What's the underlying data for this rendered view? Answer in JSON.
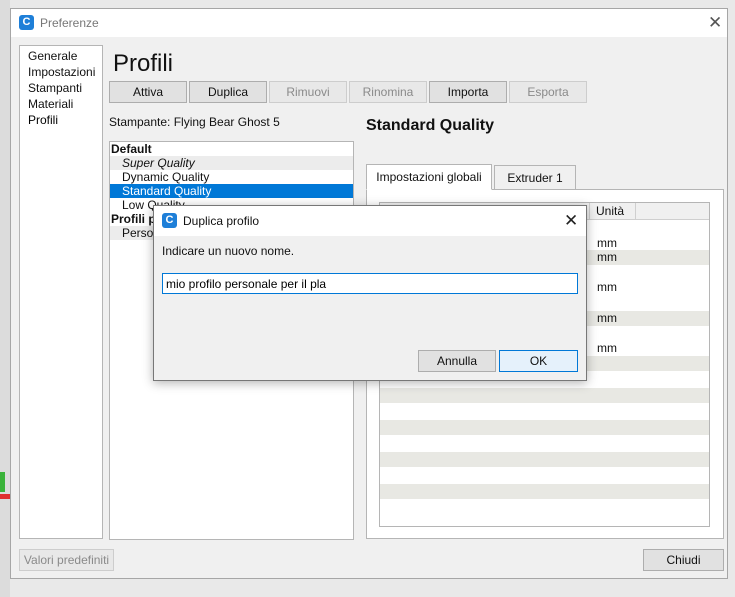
{
  "window": {
    "title": "Preferenze",
    "close_glyph": "✕",
    "logo_glyph": "C"
  },
  "sidebar": {
    "items": [
      {
        "label": "Generale"
      },
      {
        "label": "Impostazioni"
      },
      {
        "label": "Stampanti"
      },
      {
        "label": "Materiali"
      },
      {
        "label": "Profili"
      }
    ],
    "selected": "Profili"
  },
  "page": {
    "title": "Profili"
  },
  "toolbar": {
    "activate": "Attiva",
    "duplicate": "Duplica",
    "remove": "Rimuovi",
    "rename": "Rinomina",
    "import": "Importa",
    "export": "Esporta"
  },
  "printer_label": "Stampante: Flying Bear Ghost 5",
  "profile_list": {
    "default_header": "Default",
    "items": [
      "Super Quality",
      "Dynamic Quality",
      "Standard Quality",
      "Low Quality"
    ],
    "selected": "Standard Quality",
    "custom_header": "Profili p",
    "custom_items": [
      "Person"
    ]
  },
  "details": {
    "title": "Standard Quality",
    "tabs": [
      "Impostazioni globali",
      "Extruder 1"
    ],
    "active_tab": "Impostazioni globali",
    "column_unit": "Unità",
    "units": [
      "mm",
      "mm",
      "mm",
      "mm",
      "mm"
    ]
  },
  "footer": {
    "defaults_button": "Valori predefiniti",
    "close_button": "Chiudi"
  },
  "dialog": {
    "title": "Duplica profilo",
    "prompt": "Indicare un nuovo nome.",
    "input_value": "mio profilo personale per il pla",
    "cancel": "Annulla",
    "ok": "OK"
  },
  "colors": {
    "accent": "#0078d7",
    "logo": "#1e7fd8"
  }
}
